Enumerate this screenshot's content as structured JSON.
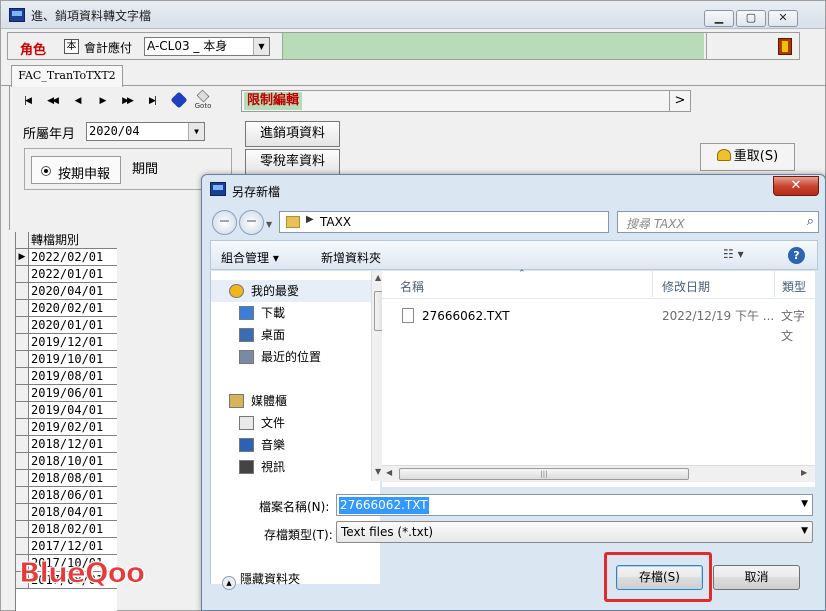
{
  "main": {
    "title": "進、銷項資料轉文字檔",
    "role_label": "角色",
    "role_flag": "本",
    "role_name": "會計應付",
    "role_value": "A-CL03 _ 本身",
    "tab_label": "FAC_TranToTXT2",
    "nav": {
      "first": "|◀",
      "prev_page": "◀◀",
      "prev": "◀",
      "next": "▶",
      "next_page": "▶▶",
      "last": "▶|",
      "goto_label": "Goto"
    },
    "limit_edit_label": "限制編輯",
    "limit_next": ">",
    "period_label": "所屬年月",
    "period_value": "2020/04",
    "btn_sales_purchase": "進銷項資料",
    "btn_zero_tax": "零稅率資料",
    "radio_apply_label": "按期申報",
    "period_text": "期間",
    "reset_label": "重取(S)",
    "grid": {
      "header": "轉檔期別",
      "current_marker": "▶",
      "rows": [
        "2022/02/01",
        "2022/01/01",
        "2020/04/01",
        "2020/02/01",
        "2020/01/01",
        "2019/12/01",
        "2019/10/01",
        "2019/08/01",
        "2019/06/01",
        "2019/04/01",
        "2019/02/01",
        "2018/12/01",
        "2018/10/01",
        "2018/08/01",
        "2018/06/01",
        "2018/04/01",
        "2018/02/01",
        "2017/12/01",
        "2017/10/01",
        "2017/08/01"
      ]
    },
    "watermark": "BlueQoo",
    "colors": {
      "role_red": "#d10000",
      "green_panel": "#b7dcb7",
      "watermark": "#e83a3a"
    }
  },
  "dialog": {
    "title": "另存新檔",
    "close_label": "✕",
    "address_path": "TAXX",
    "search_placeholder": "搜尋 TAXX",
    "organize_label": "組合管理 ▾",
    "new_folder_label": "新增資料夾",
    "help_label": "?",
    "nav_items": [
      {
        "label": "我的最愛",
        "icon": "star-icon"
      },
      {
        "label": "下載",
        "icon": "download-folder-icon"
      },
      {
        "label": "桌面",
        "icon": "desktop-icon"
      },
      {
        "label": "最近的位置",
        "icon": "recent-places-icon"
      },
      {
        "label": "媒體櫃",
        "icon": "libraries-icon"
      },
      {
        "label": "文件",
        "icon": "documents-icon"
      },
      {
        "label": "音樂",
        "icon": "music-icon"
      },
      {
        "label": "視訊",
        "icon": "videos-icon"
      }
    ],
    "columns": {
      "name": "名稱",
      "date": "修改日期",
      "type": "類型"
    },
    "files": [
      {
        "name": "27666062.TXT",
        "date": "2022/12/19 下午 ...",
        "type": "文字文"
      }
    ],
    "file_name_label": "檔案名稱(N):",
    "file_name_value": "27666062.TXT",
    "file_type_label": "存檔類型(T):",
    "file_type_value": "Text files (*.txt)",
    "hide_folders_label": "隱藏資料夾",
    "save_label": "存檔(S)",
    "cancel_label": "取消",
    "colors": {
      "selection": "#3399ff",
      "highlight_box": "#e02b2b"
    }
  }
}
